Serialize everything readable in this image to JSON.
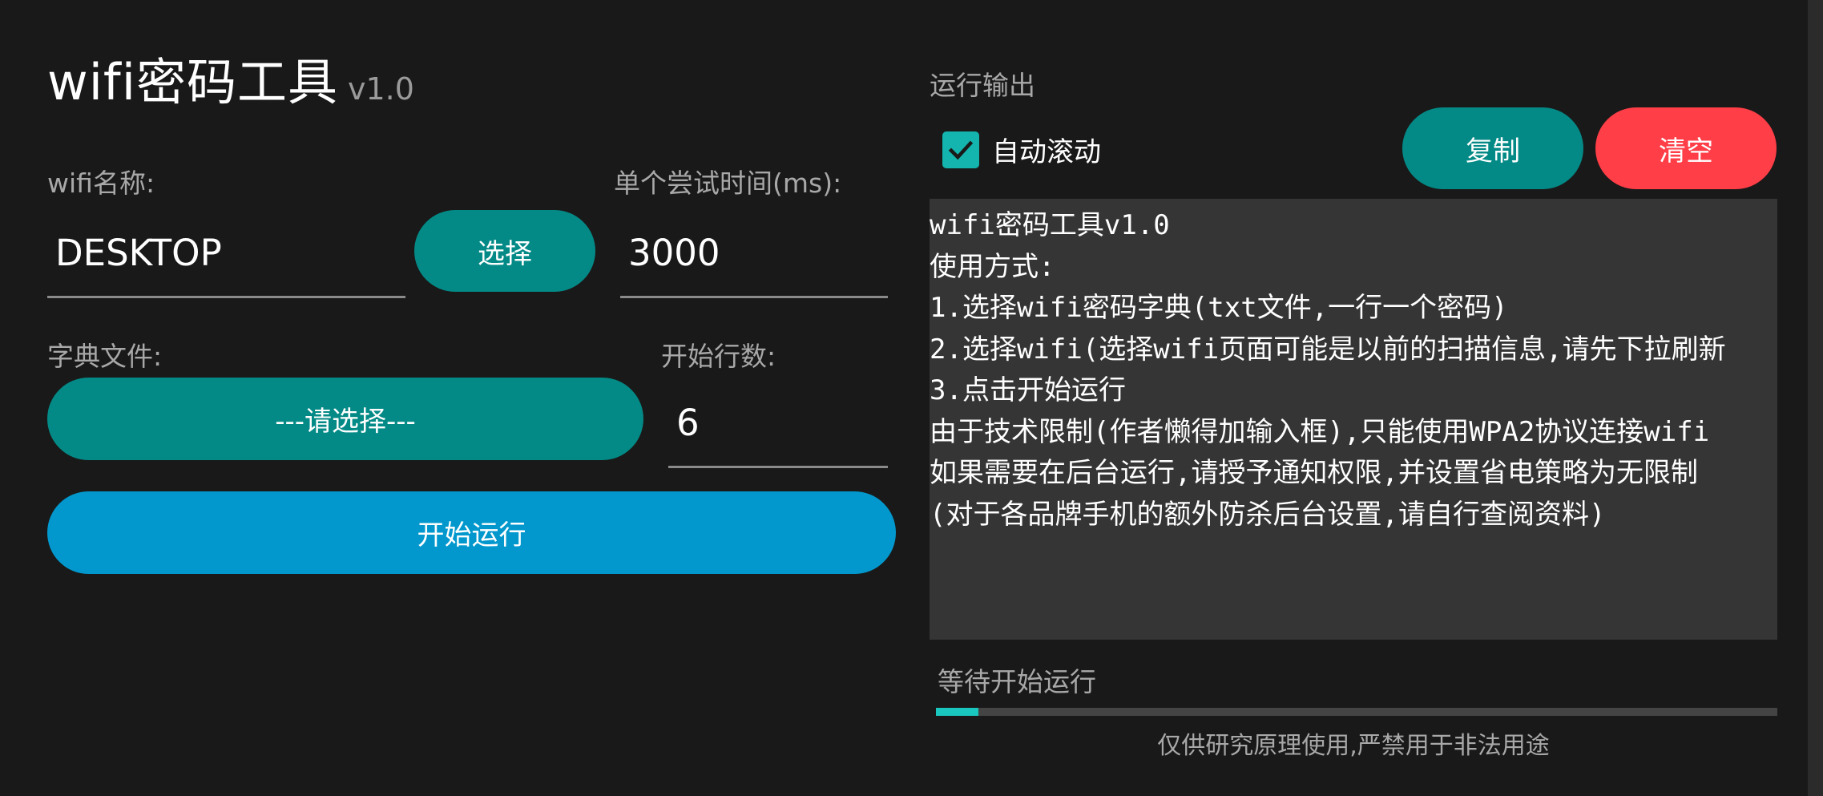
{
  "app": {
    "title": "wifi密码工具",
    "version": "v1.0"
  },
  "wifi": {
    "label": "wifi名称:",
    "value": "DESKTOP",
    "select_label": "选择"
  },
  "timeout": {
    "label": "单个尝试时间(ms):",
    "value": "3000"
  },
  "dictionary": {
    "label": "字典文件:",
    "button_label": "---请选择---"
  },
  "start_line": {
    "label": "开始行数:",
    "value": "6"
  },
  "start_button": "开始运行",
  "output": {
    "section_label": "运行输出",
    "auto_scroll": {
      "label": "自动滚动",
      "checked": true
    },
    "copy_label": "复制",
    "clear_label": "清空",
    "lines": [
      "wifi密码工具v1.0",
      "使用方式:",
      "1.选择wifi密码字典(txt文件,一行一个密码)",
      "2.选择wifi(选择wifi页面可能是以前的扫描信息,请先下拉刷新",
      "3.点击开始运行",
      "由于技术限制(作者懒得加输入框),只能使用WPA2协议连接wifi",
      "如果需要在后台运行,请授予通知权限,并设置省电策略为无限制",
      "(对于各品牌手机的额外防杀后台设置,请自行查阅资料)"
    ]
  },
  "status": {
    "text": "等待开始运行",
    "progress": 0.05
  },
  "footer": "仅供研究原理使用,严禁用于非法用途",
  "icons": {
    "checkbox_check": "check-icon"
  },
  "colors": {
    "background": "#191919",
    "teal_button": "#038a86",
    "blue_button": "#0298cd",
    "red_button": "#ff3e47",
    "checkbox": "#13b5ae",
    "progress_fill": "#19c7bf",
    "output_bg": "#353535"
  }
}
